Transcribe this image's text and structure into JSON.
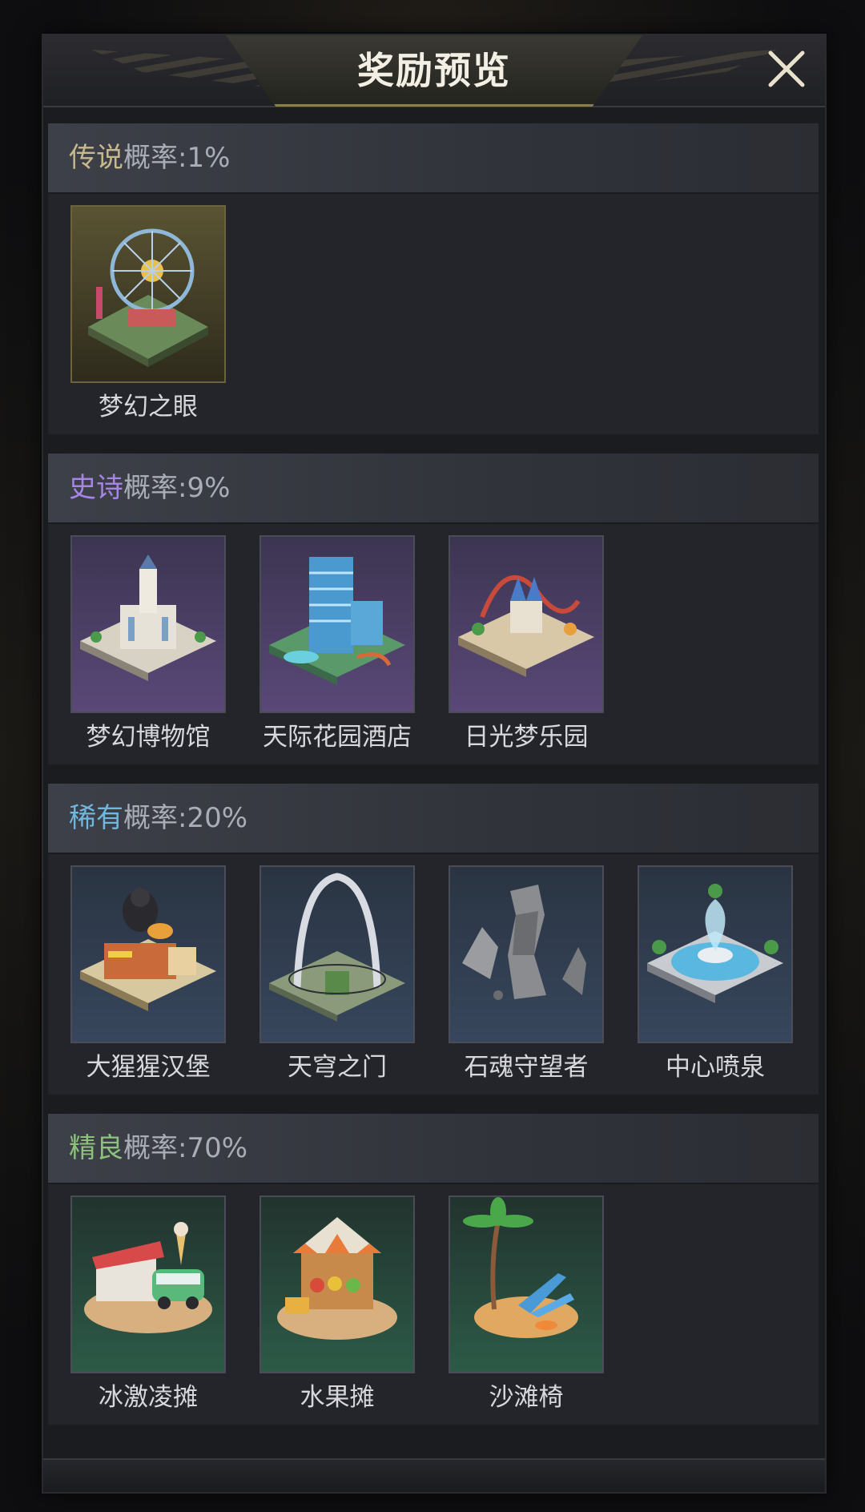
{
  "dialog": {
    "title": "奖励预览",
    "close_icon": "close-icon"
  },
  "sections": [
    {
      "rarity": "传说",
      "rate": "概率:1%",
      "rarity_color": "#c8b98c",
      "items": [
        {
          "name": "梦幻之眼",
          "icon": "ferris-wheel-icon"
        }
      ]
    },
    {
      "rarity": "史诗",
      "rate": "概率:9%",
      "rarity_color": "#a685e6",
      "items": [
        {
          "name": "梦幻博物馆",
          "icon": "museum-icon"
        },
        {
          "name": "天际花园酒店",
          "icon": "hotel-tower-icon"
        },
        {
          "name": "日光梦乐园",
          "icon": "amusement-park-icon"
        }
      ]
    },
    {
      "rarity": "稀有",
      "rate": "概率:20%",
      "rarity_color": "#6fb7de",
      "items": [
        {
          "name": "大猩猩汉堡",
          "icon": "gorilla-burger-icon"
        },
        {
          "name": "天穹之门",
          "icon": "arch-gate-icon"
        },
        {
          "name": "石魂守望者",
          "icon": "stone-statue-icon"
        },
        {
          "name": "中心喷泉",
          "icon": "fountain-icon"
        }
      ]
    },
    {
      "rarity": "精良",
      "rate": "概率:70%",
      "rarity_color": "#8cc27a",
      "items": [
        {
          "name": "冰激凌摊",
          "icon": "ice-cream-stand-icon"
        },
        {
          "name": "水果摊",
          "icon": "fruit-stand-icon"
        },
        {
          "name": "沙滩椅",
          "icon": "beach-chair-icon"
        }
      ]
    }
  ]
}
